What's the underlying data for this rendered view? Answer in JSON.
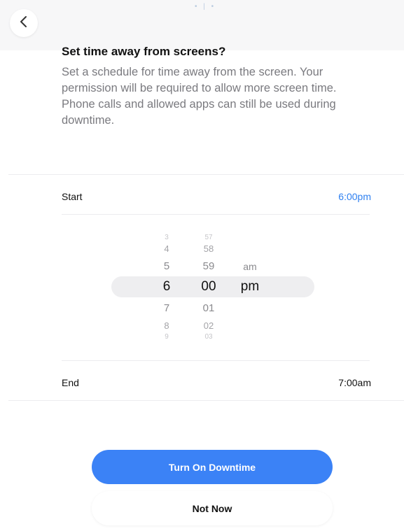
{
  "header": {
    "title": "Set time away from screens?",
    "description": "Set a schedule for time away from the screen. Your permission will be required to allow more screen time. Phone calls and allowed apps can still be used during downtime."
  },
  "schedule": {
    "start_label": "Start",
    "start_value": "6:00pm",
    "end_label": "End",
    "end_value": "7:00am"
  },
  "picker": {
    "hours": [
      "3",
      "4",
      "5",
      "6",
      "7",
      "8",
      "9"
    ],
    "minutes": [
      "57",
      "58",
      "59",
      "00",
      "01",
      "02",
      "03"
    ],
    "periods": [
      "am",
      "pm"
    ],
    "selected": {
      "hour": "6",
      "minute": "00",
      "period": "pm"
    }
  },
  "buttons": {
    "primary_label": "Turn On Downtime",
    "secondary_label": "Not Now"
  },
  "colors": {
    "accent": "#2f80f0",
    "primary_button": "#3b82f6"
  },
  "icons": {
    "back": "chevron-left-icon"
  }
}
